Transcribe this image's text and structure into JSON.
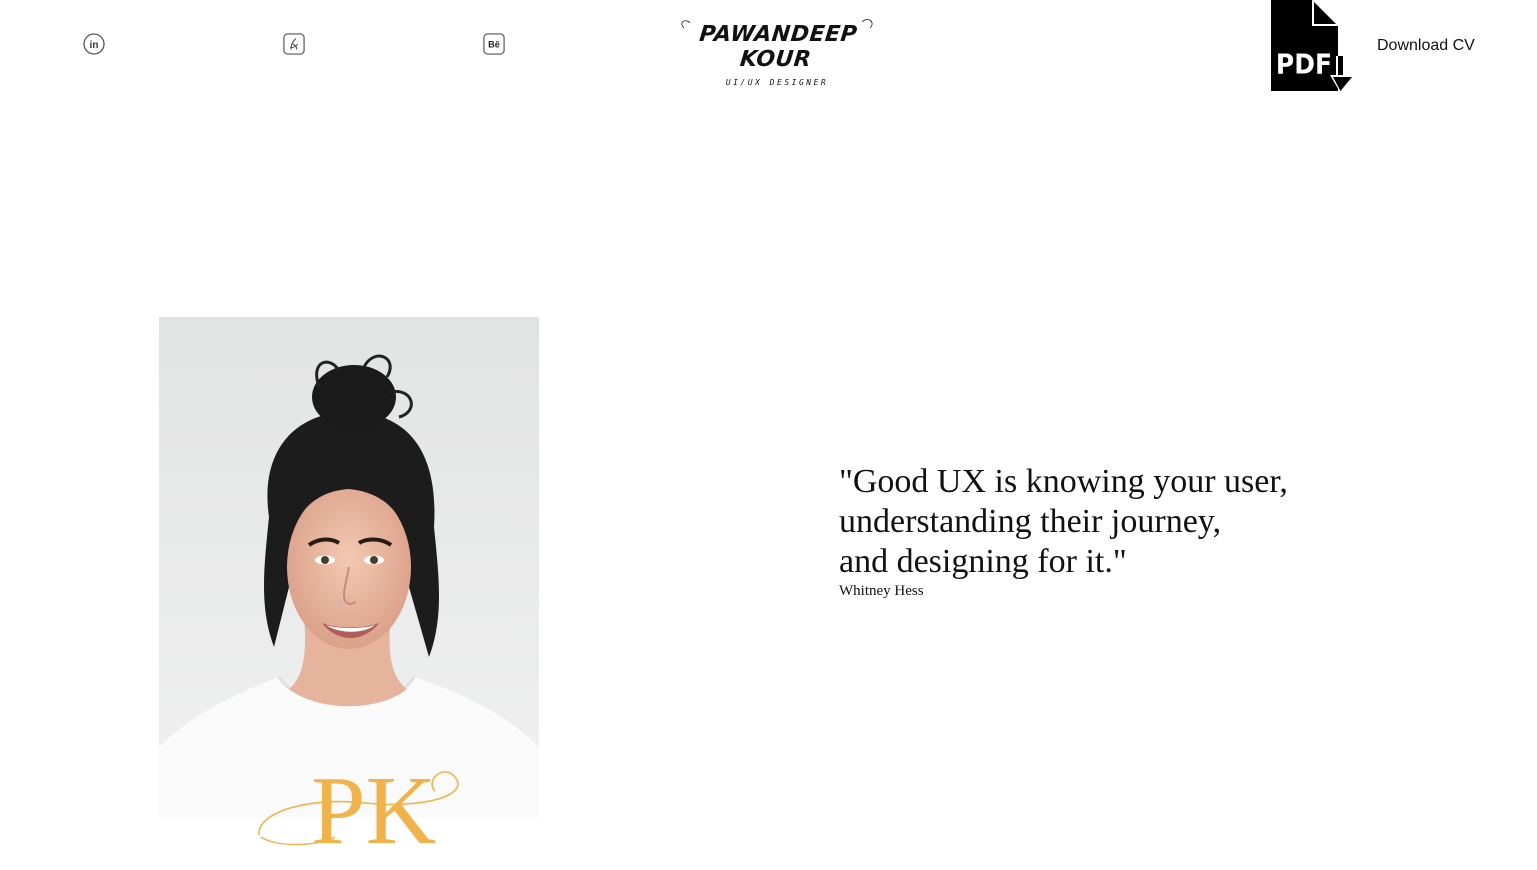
{
  "header": {
    "social": [
      {
        "name": "linkedin",
        "icon": "linkedin-icon"
      },
      {
        "name": "dribbble",
        "icon": "dribbble-icon"
      },
      {
        "name": "behance",
        "icon": "behance-icon"
      }
    ],
    "logo": {
      "name": "PAWANDEEP KOUR",
      "subtitle": "UI/UX DESIGNER"
    },
    "pdf_icon": {
      "label": "PDF",
      "icon": "pdf-download-icon"
    },
    "download_label": "Download CV"
  },
  "hero": {
    "portrait": {
      "icon": "portrait-photo"
    },
    "monogram": {
      "text": "PK",
      "color": "#f2b24a"
    }
  },
  "quote": {
    "lines": [
      "\"Good UX is knowing your user,",
      "understanding their journey,",
      "and designing for it.\""
    ],
    "author": "Whitney Hess"
  }
}
